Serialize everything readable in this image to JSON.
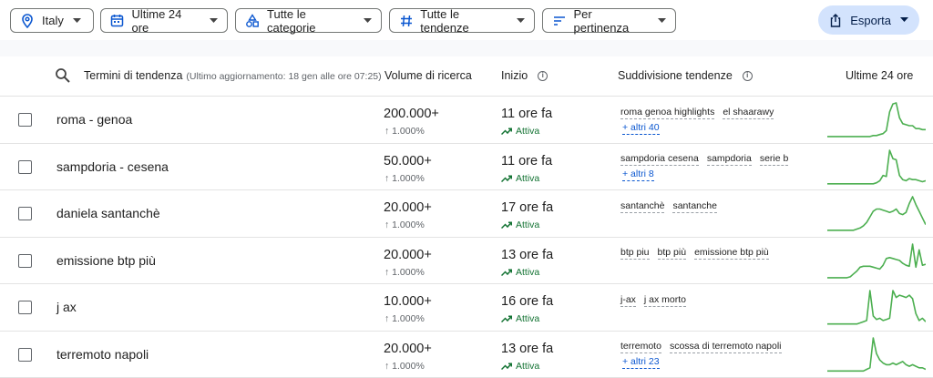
{
  "filters": {
    "country": "Italy",
    "time": "Ultime 24 ore",
    "category": "Tutte le categorie",
    "trend": "Tutte le tendenze",
    "sort": "Per pertinenza",
    "export": "Esporta"
  },
  "table": {
    "headers": {
      "term": "Termini di tendenza",
      "term_note": "(Ultimo aggiornamento: 18 gen alle ore 07:25)",
      "volume": "Volume di ricerca",
      "start": "Inizio",
      "breakdown": "Suddivisione tendenze",
      "last": "Ultime 24 ore"
    },
    "rows": [
      {
        "term": "roma - genoa",
        "volume": "200.000+",
        "pct": "↑ 1.000%",
        "start": "11 ore fa",
        "status": "Attiva",
        "tags": [
          "roma genoa highlights",
          "el shaarawy"
        ],
        "more": "+ altri 40",
        "spark": [
          1,
          1,
          1,
          1,
          1,
          1,
          1,
          1,
          1,
          1,
          1,
          1,
          1,
          1,
          2,
          2,
          3,
          4,
          7,
          26,
          34,
          35,
          20,
          14,
          13,
          12,
          12,
          9,
          9,
          8,
          8
        ]
      },
      {
        "term": "sampdoria - cesena",
        "volume": "50.000+",
        "pct": "↑ 1.000%",
        "start": "11 ore fa",
        "status": "Attiva",
        "tags": [
          "sampdoria cesena",
          "sampdoria",
          "serie b"
        ],
        "more": "+ altri 8",
        "spark": [
          1,
          1,
          1,
          1,
          1,
          1,
          1,
          1,
          1,
          1,
          1,
          1,
          1,
          1,
          1,
          2,
          4,
          9,
          8,
          33,
          25,
          24,
          9,
          5,
          4,
          6,
          5,
          5,
          4,
          3,
          4
        ]
      },
      {
        "term": "daniela santanchè",
        "volume": "20.000+",
        "pct": "↑ 1.000%",
        "start": "17 ore fa",
        "status": "Attiva",
        "tags": [
          "santanchè",
          "santanche"
        ],
        "more": "",
        "spark": [
          1,
          1,
          1,
          1,
          1,
          1,
          1,
          1,
          1,
          2,
          3,
          5,
          8,
          13,
          18,
          20,
          20,
          19,
          18,
          17,
          18,
          20,
          16,
          15,
          17,
          25,
          31,
          24,
          18,
          12,
          6
        ]
      },
      {
        "term": "emissione btp più",
        "volume": "20.000+",
        "pct": "↑ 1.000%",
        "start": "13 ore fa",
        "status": "Attiva",
        "tags": [
          "btp piu",
          "btp più",
          "emissione btp più"
        ],
        "more": "",
        "spark": [
          1,
          1,
          1,
          1,
          1,
          1,
          1,
          2,
          5,
          8,
          12,
          13,
          13,
          13,
          12,
          11,
          10,
          14,
          21,
          22,
          21,
          20,
          19,
          16,
          14,
          13,
          36,
          12,
          30,
          14,
          15
        ]
      },
      {
        "term": "j ax",
        "volume": "10.000+",
        "pct": "↑ 1.000%",
        "start": "16 ore fa",
        "status": "Attiva",
        "tags": [
          "j-ax",
          "j ax morto"
        ],
        "more": "",
        "spark": [
          1,
          1,
          1,
          1,
          1,
          1,
          1,
          1,
          1,
          1,
          2,
          3,
          4,
          30,
          8,
          5,
          6,
          4,
          5,
          6,
          30,
          24,
          26,
          25,
          24,
          26,
          23,
          10,
          4,
          6,
          3
        ]
      },
      {
        "term": "terremoto napoli",
        "volume": "20.000+",
        "pct": "↑ 1.000%",
        "start": "13 ore fa",
        "status": "Attiva",
        "tags": [
          "terremoto",
          "scossa di terremoto napoli"
        ],
        "more": "+ altri 23",
        "spark": [
          1,
          1,
          1,
          1,
          1,
          1,
          1,
          1,
          1,
          1,
          1,
          1,
          2,
          3,
          22,
          12,
          8,
          6,
          5,
          5,
          6,
          5,
          6,
          7,
          5,
          4,
          5,
          4,
          3,
          3,
          2
        ]
      }
    ]
  },
  "colors": {
    "accent": "#0b57d0",
    "export_bg": "#d3e3fd",
    "spark": "#4caf50",
    "active": "#137333"
  }
}
